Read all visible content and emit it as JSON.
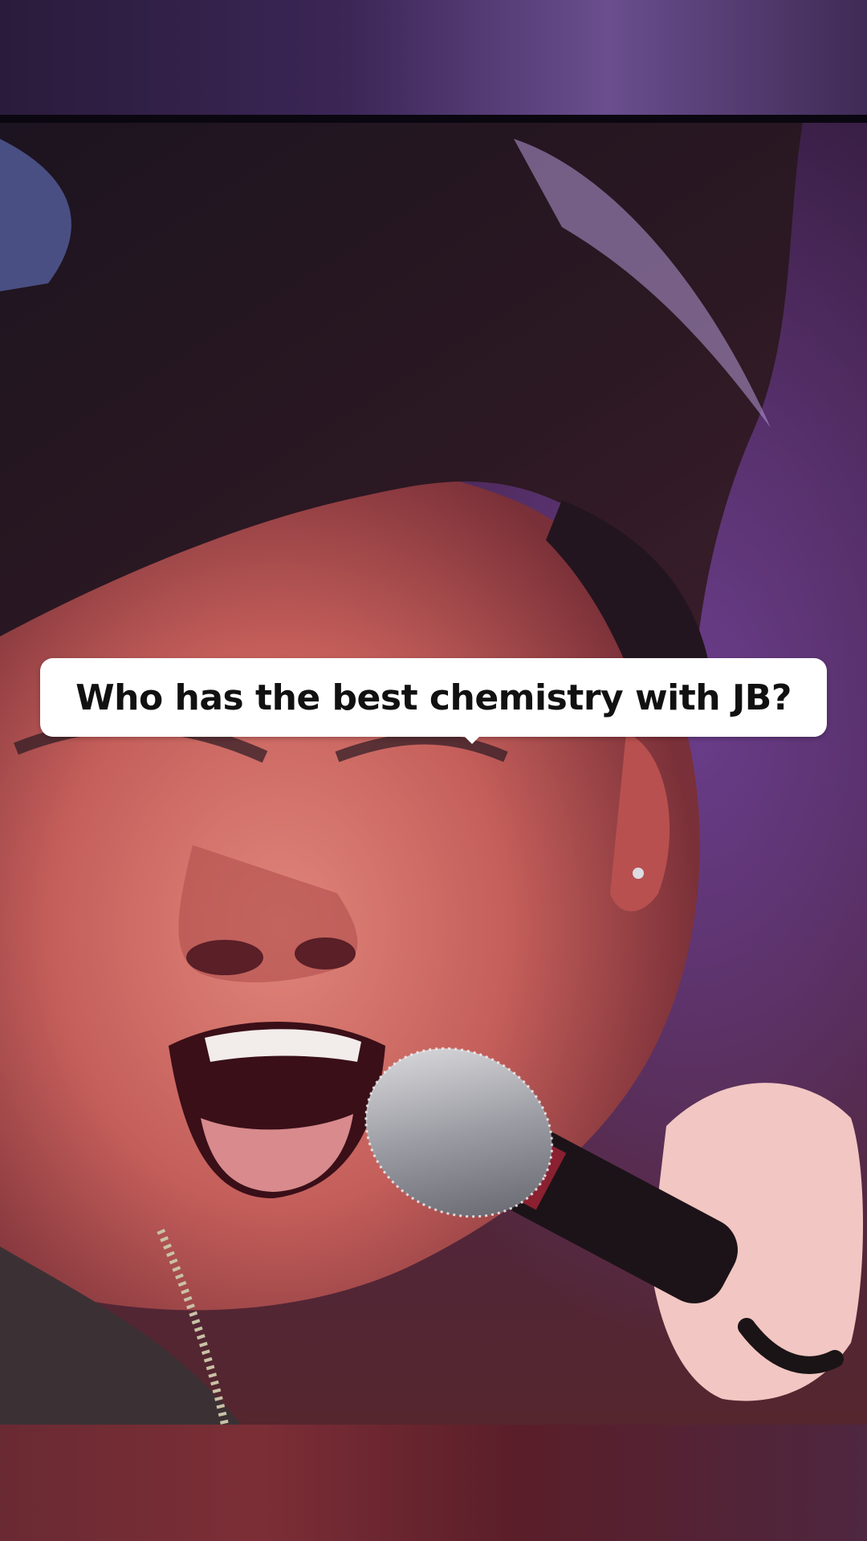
{
  "caption": {
    "text": "Who has the best chemistry with JB?"
  },
  "video": {
    "subject": "singer-closeup-photo"
  },
  "colors": {
    "top_letterbox": "#3b2656",
    "bottom_letterbox": "#6a2a33",
    "caption_bg": "#ffffff",
    "caption_text": "#111111"
  }
}
